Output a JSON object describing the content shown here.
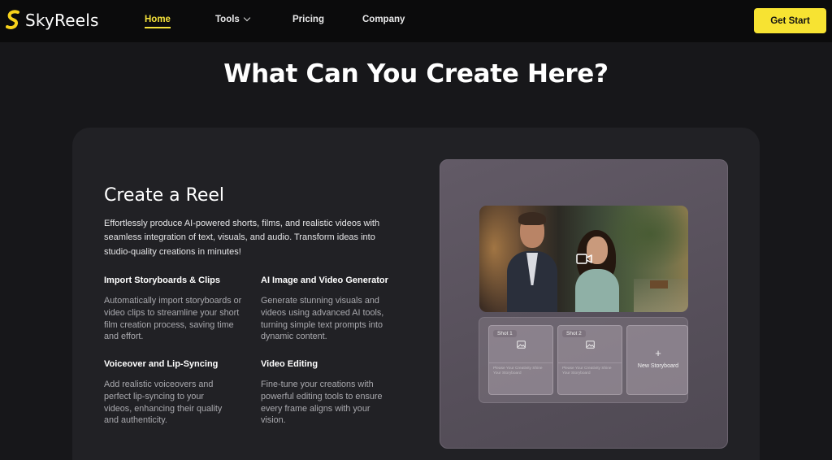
{
  "nav": {
    "brand": "SkyReels",
    "items": [
      {
        "label": "Home"
      },
      {
        "label": "Tools"
      },
      {
        "label": "Pricing"
      },
      {
        "label": "Company"
      }
    ],
    "cta": "Get Start",
    "accent": "#f7e332"
  },
  "headline": "What Can You Create Here?",
  "card": {
    "title": "Create a Reel",
    "description": "Effortlessly produce AI-powered shorts, films, and realistic videos with seamless integration of text, visuals, and audio. Transform ideas into studio-quality creations in minutes!",
    "features": [
      {
        "title": "Import Storyboards & Clips",
        "description": "Automatically import storyboards or video clips to streamline your short film creation process, saving time and effort."
      },
      {
        "title": "AI Image and Video Generator",
        "description": "Generate stunning visuals and videos using advanced AI tools, turning simple text prompts into dynamic content."
      },
      {
        "title": "Voiceover and Lip-Syncing",
        "description": "Add realistic voiceovers and perfect lip-syncing to your videos, enhancing their quality and authenticity."
      },
      {
        "title": "Video Editing",
        "description": "Fine-tune your creations with powerful editing tools to ensure every frame aligns with your vision."
      }
    ]
  },
  "preview": {
    "shots": [
      {
        "label": "Shot 1",
        "placeholder": "Please Your Creativity Shine Your Storyboard"
      },
      {
        "label": "Shot 2",
        "placeholder": "Please Your Creativity Shine Your Storyboard"
      }
    ],
    "new_storyboard": "New Storyboard",
    "plus": "+"
  }
}
